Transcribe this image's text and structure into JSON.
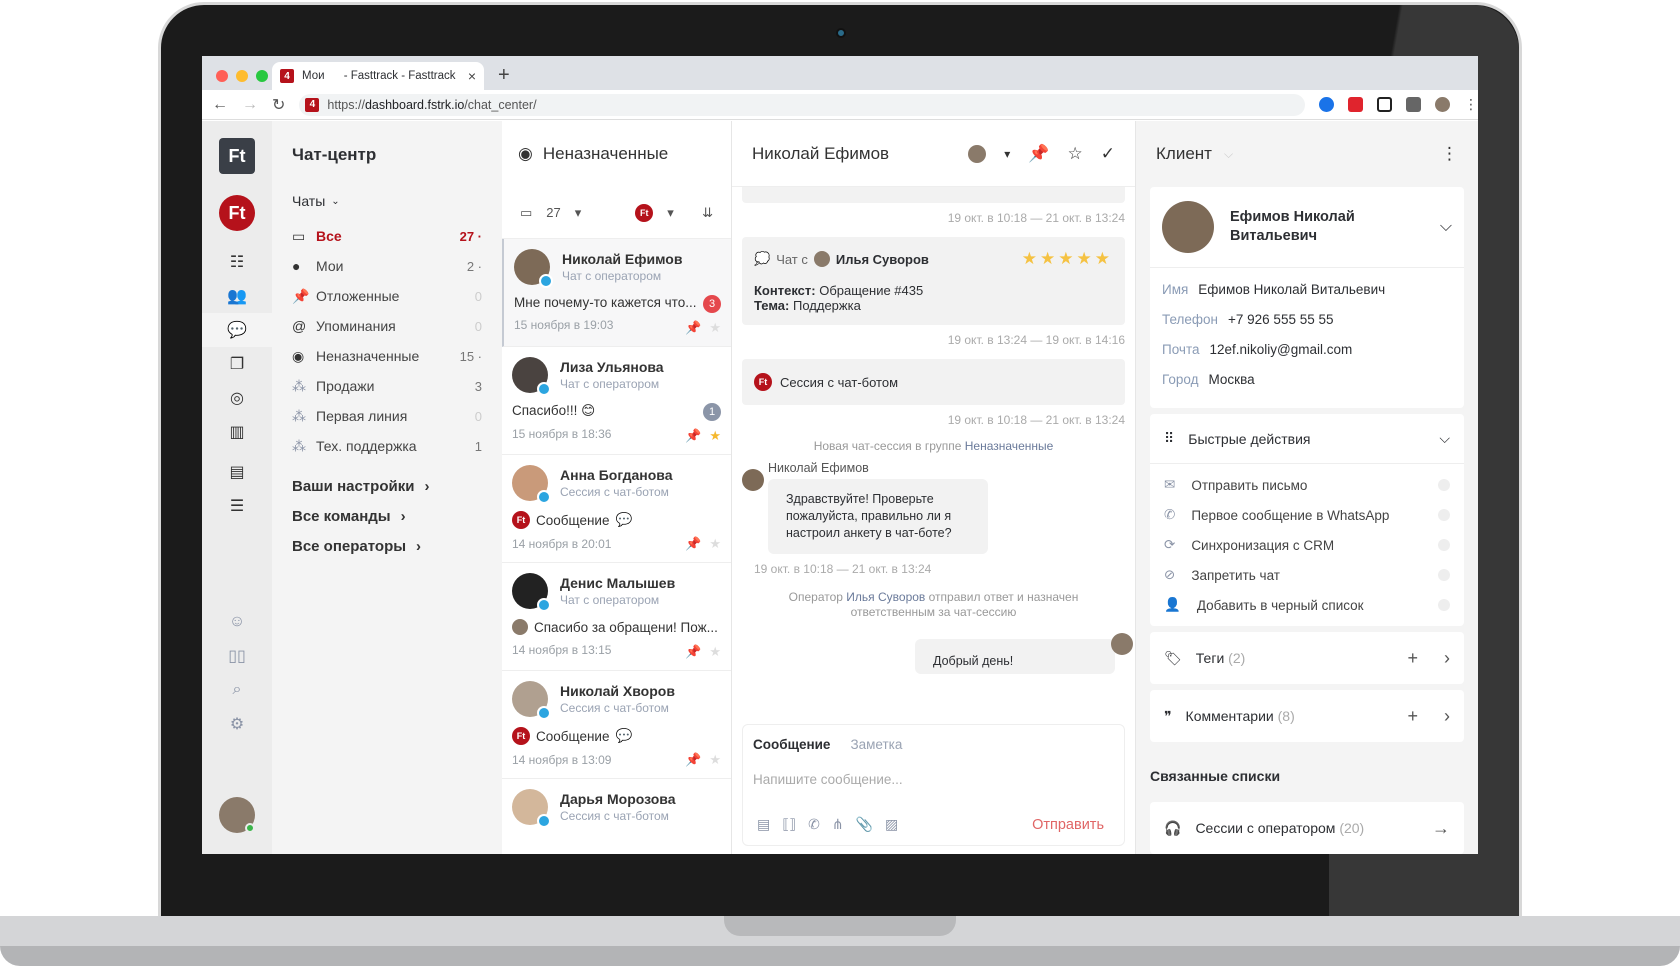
{
  "browser": {
    "tab_title": "Мои      - Fasttrack - Fasttrack",
    "tab_badge": "4",
    "url_prefix": "https://",
    "url_host": "dashboard.fstrk.io",
    "url_path": "/chat_center/",
    "new_tab": "+",
    "close_tab": "×"
  },
  "rail": {
    "logo": "Ft",
    "workspace": "Ft",
    "icons": [
      "hierarchy-icon",
      "users-icon",
      "chat-icon",
      "copy-icon",
      "target-icon",
      "analytics-icon",
      "table-icon",
      "layers-icon",
      "masks-icon",
      "book-icon",
      "search-icon",
      "gear-icon"
    ]
  },
  "nav": {
    "title": "Чат-центр",
    "section": "Чаты",
    "items": [
      {
        "label": "Все",
        "count": "27 ·",
        "icon": "inbox-icon",
        "active": true
      },
      {
        "label": "Мои",
        "count": "2 ·",
        "icon": "avatar-icon"
      },
      {
        "label": "Отложенные",
        "count": "0",
        "icon": "pin-icon"
      },
      {
        "label": "Упоминания",
        "count": "0",
        "icon": "at-icon"
      },
      {
        "label": "Неназначенные",
        "count": "15 ·",
        "icon": "user-circle-icon"
      },
      {
        "label": "Продажи",
        "count": "3",
        "icon": "team-icon"
      },
      {
        "label": "Первая линия",
        "count": "0",
        "icon": "team-icon"
      },
      {
        "label": "Тех. поддержка",
        "count": "1",
        "icon": "team-icon"
      }
    ],
    "links": [
      "Ваши настройки",
      "Все команды",
      "Все операторы"
    ]
  },
  "list": {
    "title": "Неназначенные",
    "count": "27",
    "items": [
      {
        "name": "Николай Ефимов",
        "sub": "Чат с оператором",
        "msg": "Мне почему-то кажется что...",
        "date": "15 ноября в 19:03",
        "badge": "3",
        "badge_color": "#e5484d"
      },
      {
        "name": "Лиза Ульянова",
        "sub": "Чат с оператором",
        "msg": "Спасибо!!! 😊",
        "date": "15 ноября в 18:36",
        "badge": "1",
        "badge_color": "#8b95a8",
        "starred": true
      },
      {
        "name": "Анна Богданова",
        "sub": "Сессия с чат-ботом",
        "msg": "Сообщение",
        "date": "14 ноября в 20:01",
        "bot": true
      },
      {
        "name": "Денис Малышев",
        "sub": "Чат с оператором",
        "msg": "Спасибо за обращени! Пож...",
        "date": "14 ноября в 13:15",
        "pinned": true
      },
      {
        "name": "Николай Хворов",
        "sub": "Сессия с чат-ботом",
        "msg": "Сообщение",
        "date": "14 ноября в 13:09",
        "bot": true
      },
      {
        "name": "Дарья Морозова",
        "sub": "Сессия с чат-ботом",
        "msg": "",
        "date": ""
      }
    ]
  },
  "chat": {
    "title": "Николай Ефимов",
    "ts1": "19 окт. в 10:18 — 21 окт. в 13:24",
    "card": {
      "chat_with": "Чат с",
      "operator": "Илья Суворов",
      "rating": 5,
      "context_label": "Контекст:",
      "context": "Обращение #435",
      "topic_label": "Тема:",
      "topic": "Поддержка"
    },
    "ts2": "19 окт. в 13:24 — 19 окт. в 14:16",
    "bot_session": "Сессия с чат-ботом",
    "ts3": "19 окт. в 10:18 — 21 окт. в 13:24",
    "sys1_pre": "Новая чат-сессия в группе ",
    "sys1_link": "Неназначенные",
    "author": "Николай Ефимов",
    "bubble": "Здравствуйте! Проверьте пожалуйста, правильно ли я настроил анкету в чат-боте?",
    "bubble_ts": "19 окт. в 10:18 — 21 окт. в 13:24",
    "sys2_pre": "Оператор ",
    "sys2_link": "Илья Суворов",
    "sys2_post": " отправил ответ и назначен ответственным за чат-сессию",
    "reply": "Добрый день!",
    "composer": {
      "tab_message": "Сообщение",
      "tab_note": "Заметка",
      "placeholder": "Напишите сообщение...",
      "send": "Отправить"
    }
  },
  "client": {
    "title": "Клиент",
    "name": "Ефимов Николай Витальевич",
    "fields": [
      {
        "label": "Имя",
        "value": "Ефимов Николай Витальевич"
      },
      {
        "label": "Телефон",
        "value": "+7 926 555 55 55"
      },
      {
        "label": "Почта",
        "value": "12ef.nikoliy@gmail.com"
      },
      {
        "label": "Город",
        "value": "Москва"
      }
    ],
    "quick_title": "Быстрые действия",
    "quick": [
      {
        "label": "Отправить письмо",
        "icon": "mail-icon"
      },
      {
        "label": "Первое сообщение в WhatsApp",
        "icon": "whatsapp-icon"
      },
      {
        "label": "Синхронизация с CRM",
        "icon": "sync-icon"
      },
      {
        "label": "Запретить чат",
        "icon": "block-chat-icon"
      },
      {
        "label": "Добавить в черный список",
        "icon": "blacklist-icon"
      }
    ],
    "tags_label": "Теги",
    "tags_count": "(2)",
    "comments_label": "Комментарии",
    "comments_count": "(8)",
    "related_title": "Связанные списки",
    "sessions_label": "Сессии с оператором",
    "sessions_count": "(20)"
  }
}
